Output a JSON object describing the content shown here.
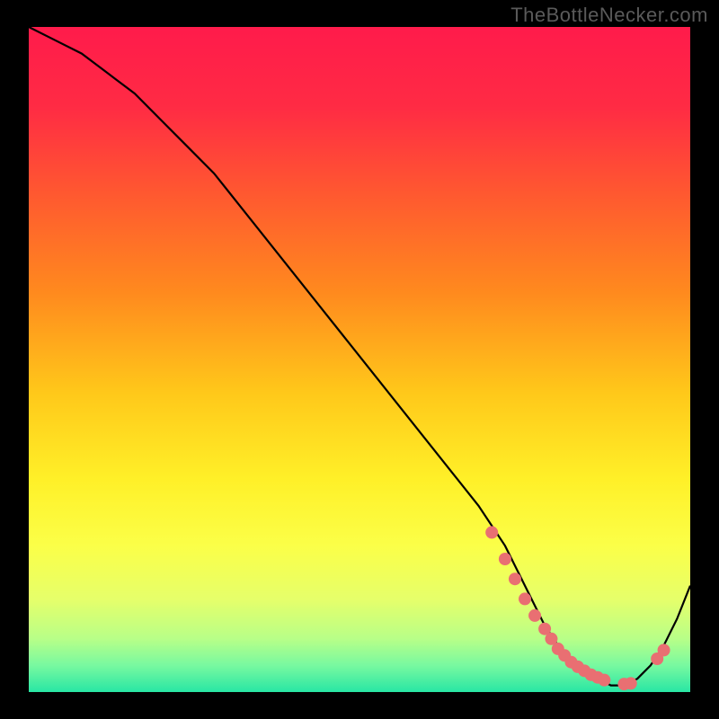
{
  "watermark": "TheBottleNecker.com",
  "chart_data": {
    "type": "line",
    "title": "",
    "xlabel": "",
    "ylabel": "",
    "xlim": [
      0,
      100
    ],
    "ylim": [
      0,
      100
    ],
    "background_gradient": {
      "stops": [
        {
          "offset": 0.0,
          "color": "#ff1b4b"
        },
        {
          "offset": 0.12,
          "color": "#ff2b44"
        },
        {
          "offset": 0.25,
          "color": "#ff5830"
        },
        {
          "offset": 0.4,
          "color": "#ff8a1e"
        },
        {
          "offset": 0.55,
          "color": "#ffc81a"
        },
        {
          "offset": 0.68,
          "color": "#fff028"
        },
        {
          "offset": 0.78,
          "color": "#fbff48"
        },
        {
          "offset": 0.86,
          "color": "#e6ff6a"
        },
        {
          "offset": 0.92,
          "color": "#b8ff88"
        },
        {
          "offset": 0.96,
          "color": "#78f9a0"
        },
        {
          "offset": 1.0,
          "color": "#28e6a4"
        }
      ]
    },
    "series": [
      {
        "name": "curve",
        "x": [
          0,
          4,
          8,
          12,
          16,
          20,
          24,
          28,
          32,
          36,
          40,
          44,
          48,
          52,
          56,
          60,
          64,
          68,
          72,
          74,
          76,
          78,
          80,
          82,
          84,
          86,
          88,
          90,
          92,
          94,
          96,
          98,
          100
        ],
        "y": [
          100,
          98,
          96,
          93,
          90,
          86,
          82,
          78,
          73,
          68,
          63,
          58,
          53,
          48,
          43,
          38,
          33,
          28,
          22,
          18,
          14,
          10,
          7,
          5,
          3,
          2,
          1,
          1,
          2,
          4,
          7,
          11,
          16
        ]
      }
    ],
    "markers": {
      "x": [
        70,
        72,
        73.5,
        75,
        76.5,
        78,
        79,
        80,
        81,
        82,
        83,
        84,
        85,
        86,
        87,
        90,
        91,
        95,
        96
      ],
      "y": [
        24,
        20,
        17,
        14,
        11.5,
        9.5,
        8,
        6.5,
        5.5,
        4.5,
        3.8,
        3.2,
        2.6,
        2.2,
        1.8,
        1.2,
        1.3,
        5,
        6.3
      ],
      "color": "#e96f72",
      "radius": 7
    }
  }
}
